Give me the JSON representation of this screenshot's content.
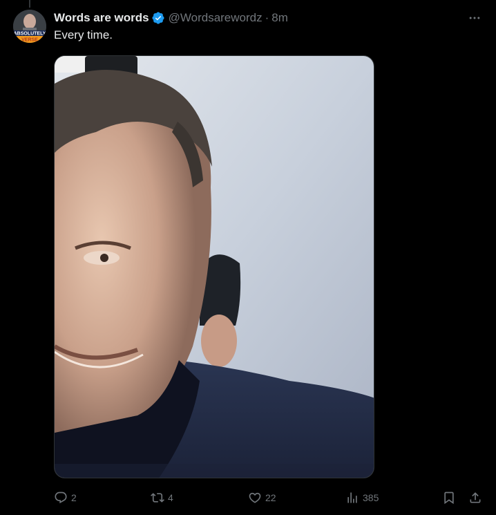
{
  "tweet": {
    "display_name": "Words are words",
    "verified": true,
    "handle": "@Wordsarewordz",
    "separator": "·",
    "time": "8m",
    "text": "Every time.",
    "avatar_caption": "ABSOLUTELY",
    "avatar_caption2": "VERSE",
    "media_description_icon": "photo"
  },
  "actions": {
    "reply": {
      "icon": "reply-icon",
      "count": "2"
    },
    "retweet": {
      "icon": "retweet-icon",
      "count": "4"
    },
    "like": {
      "icon": "heart-icon",
      "count": "22"
    },
    "views": {
      "icon": "views-icon",
      "count": "385"
    },
    "bookmark": {
      "icon": "bookmark-icon"
    },
    "share": {
      "icon": "share-icon"
    }
  },
  "colors": {
    "background": "#000000",
    "primary_text": "#e7e9ea",
    "secondary_text": "#71767b",
    "verified_blue": "#1d9bf0",
    "border": "#2f3336"
  }
}
